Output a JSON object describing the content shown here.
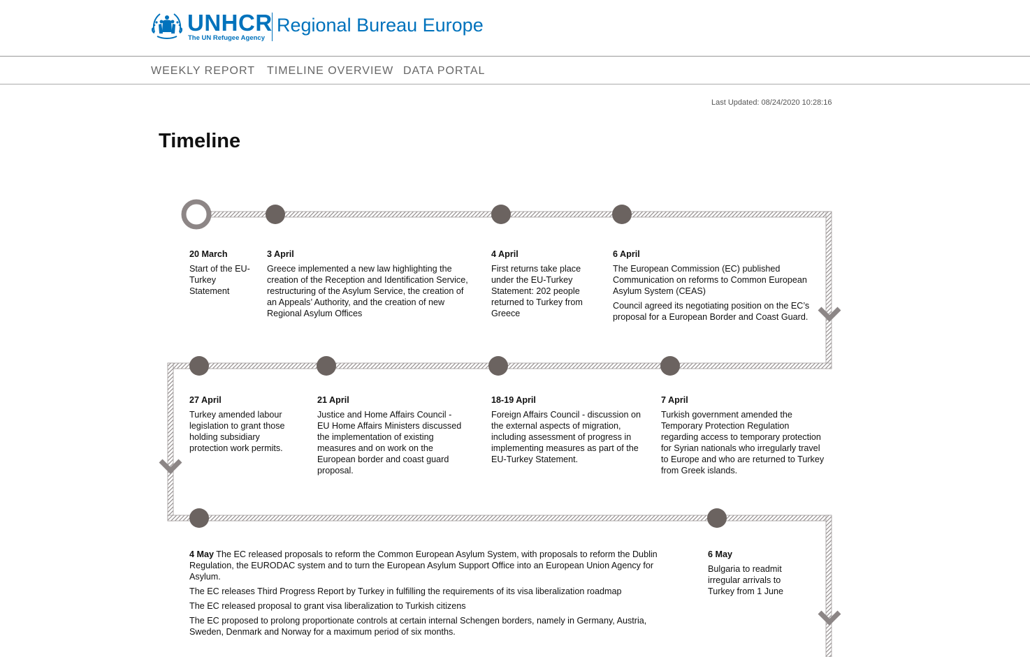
{
  "header": {
    "logo_name": "UNHCR",
    "logo_subtitle": "The UN Refugee Agency",
    "title": "Regional Bureau Europe"
  },
  "nav": {
    "items": [
      {
        "label": "WEEKLY REPORT"
      },
      {
        "label": "TIMELINE OVERVIEW"
      },
      {
        "label": "DATA PORTAL"
      }
    ]
  },
  "last_updated": "Last Updated: 08/24/2020 10:28:16",
  "page_title": "Timeline",
  "colors": {
    "brand_blue": "#0072bc",
    "node_fill": "#6b6360",
    "track": "#9a9595"
  },
  "events": [
    {
      "date": "20 March",
      "text": [
        "Start of the EU-Turkey Statement"
      ]
    },
    {
      "date": "3 April",
      "text": [
        "Greece implemented a new law highlighting the creation of the Reception and Identification Service, restructuring of the Asylum Service, the creation of an Appeals’ Authority, and the creation of new Regional Asylum Offices"
      ]
    },
    {
      "date": "4 April",
      "text": [
        "First returns take place under the EU-Turkey Statement: 202 people returned to Turkey from Greece"
      ]
    },
    {
      "date": "6 April",
      "text": [
        "The European Commission (EC) published Communication on reforms to Common European Asylum System (CEAS)",
        "Council agreed its negotiating position on the EC’s proposal for a European Border and Coast Guard."
      ]
    },
    {
      "date": "27 April",
      "text": [
        "Turkey amended labour legislation to grant those holding subsidiary protection work permits."
      ]
    },
    {
      "date": "21 April",
      "text": [
        "Justice and Home Affairs Council - EU Home Affairs Ministers discussed the implementation of existing measures and on work on the European border and coast guard proposal."
      ]
    },
    {
      "date": "18-19 April",
      "text": [
        "Foreign Affairs Council - discussion on the external aspects of migration, including assessment of progress in implementing measures as part of the EU-Turkey Statement."
      ]
    },
    {
      "date": "7 April",
      "text": [
        "Turkish government amended the Temporary Protection Regulation regarding access to temporary protection for Syrian nationals who irregularly travel to Europe and who are returned to Turkey from Greek islands."
      ]
    },
    {
      "date": "4 May",
      "text": [
        "The EC released proposals to reform the Common European Asylum System, with proposals to reform the Dublin Regulation, the EURODAC system and to turn the European Asylum Support Office into an European Union Agency for Asylum.",
        "The EC releases Third Progress Report by Turkey in fulfilling the requirements of its visa liberalization roadmap",
        "The EC released proposal to grant visa liberalization to Turkish citizens",
        "The EC proposed to prolong proportionate controls at certain internal Schengen borders, namely in Germany, Austria, Sweden, Denmark and Norway for a maximum period of six months."
      ]
    },
    {
      "date": "6 May",
      "text": [
        "Bulgaria to readmit irregular arrivals to Turkey from 1 June"
      ]
    }
  ]
}
